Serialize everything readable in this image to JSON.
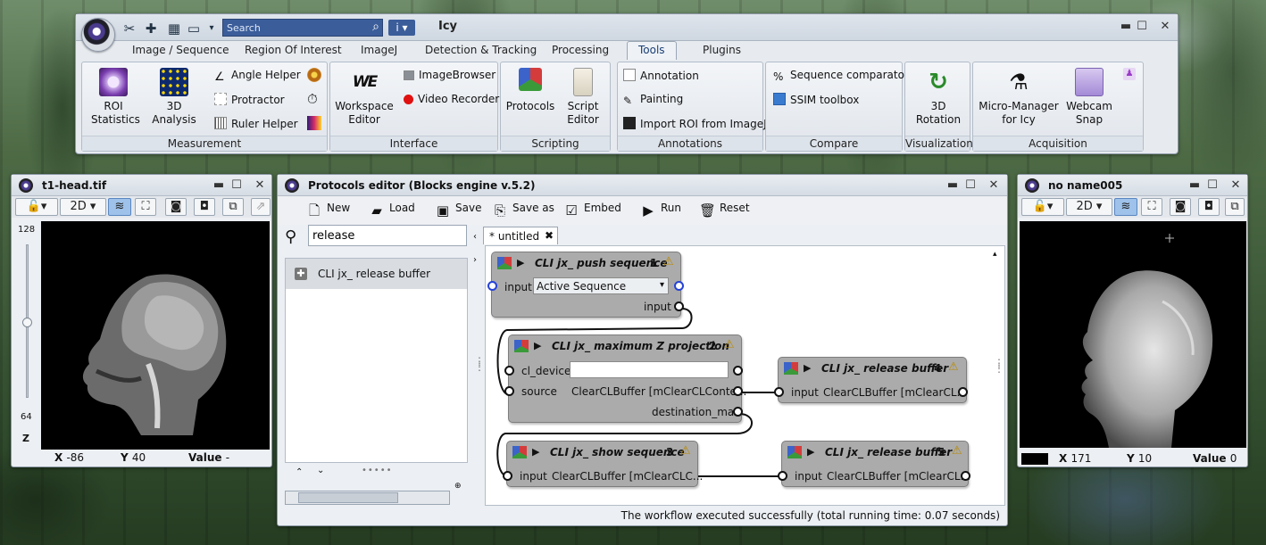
{
  "app": {
    "title": "Icy",
    "search_placeholder": "Search"
  },
  "ribbon": {
    "tabs": [
      "Image / Sequence",
      "Region Of Interest",
      "ImageJ",
      "Detection & Tracking",
      "Processing",
      "Tools",
      "Plugins"
    ],
    "active_tab": "Tools",
    "groups": {
      "measurement": {
        "label": "Measurement",
        "roi_statistics": [
          "ROI",
          "Statistics"
        ],
        "analysis_3d": [
          "3D",
          "Analysis"
        ],
        "angle_helper": "Angle Helper",
        "protractor": "Protractor",
        "ruler_helper": "Ruler Helper"
      },
      "interface": {
        "label": "Interface",
        "workspace_editor": [
          "Workspace",
          "Editor"
        ],
        "image_browser": "ImageBrowser",
        "video_recorder": "Video Recorder"
      },
      "scripting": {
        "label": "Scripting",
        "protocols": "Protocols",
        "script_editor": [
          "Script",
          "Editor"
        ]
      },
      "annotations": {
        "label": "Annotations",
        "annotation": "Annotation",
        "painting": "Painting",
        "import_roi": "Import ROI from ImageJ"
      },
      "compare": {
        "label": "Compare",
        "sequence_comparator": "Sequence comparator",
        "ssim": "SSIM toolbox"
      },
      "visualization": {
        "label": "Visualization",
        "rotation_3d": [
          "3D",
          "Rotation"
        ]
      },
      "acquisition": {
        "label": "Acquisition",
        "micro_manager": [
          "Micro-Manager",
          "for Icy"
        ],
        "webcam": [
          "Webcam",
          "Snap"
        ]
      }
    }
  },
  "viewer1": {
    "title": "t1-head.tif",
    "mode": "2D",
    "slider_max": "128",
    "slider_mid": "64",
    "axis": "Z",
    "x_label": "X",
    "x": "-86",
    "y_label": "Y",
    "y": "40",
    "value_label": "Value",
    "value": "-"
  },
  "viewer2": {
    "title": "no name005",
    "mode": "2D",
    "x_label": "X",
    "x": "171",
    "y_label": "Y",
    "y": "10",
    "value_label": "Value",
    "value": "0"
  },
  "protocols": {
    "title": "Protocols editor (Blocks engine v.5.2)",
    "toolbar": {
      "new": "New",
      "load": "Load",
      "save": "Save",
      "save_as": "Save as",
      "embed": "Embed",
      "run": "Run",
      "reset": "Reset"
    },
    "search_value": "release",
    "results": [
      "CLI jx_ release buffer"
    ],
    "tab": "* untitled",
    "status": "The workflow executed successfully (total running time: 0.07 seconds)",
    "blocks": [
      {
        "title": "CLI jx_ push sequence",
        "num": "1",
        "rows": {
          "input_label": "input",
          "input_value": "Active Sequence",
          "output_label": "input"
        }
      },
      {
        "title": "CLI jx_ maximum Z projection",
        "num": "2",
        "rows": {
          "cl_device": "cl_device",
          "source": "source",
          "source_value": "ClearCLBuffer [mClearCLConte...",
          "out": "destination_max"
        }
      },
      {
        "title": "CLI jx_ show sequence",
        "num": "3",
        "rows": {
          "input_label": "input",
          "input_value": "ClearCLBuffer [mClearCLC..."
        }
      },
      {
        "title": "CLI jx_ release buffer",
        "num": "4",
        "rows": {
          "input_label": "input",
          "input_value": "ClearCLBuffer [mClearCL..."
        }
      },
      {
        "title": "CLI jx_ release buffer",
        "num": "5",
        "rows": {
          "input_label": "input",
          "input_value": "ClearCLBuffer [mClearCL..."
        }
      }
    ]
  },
  "colors": {
    "accent": "#3b5d9a",
    "block": "#ababab",
    "selected": "#9ec2ea"
  }
}
